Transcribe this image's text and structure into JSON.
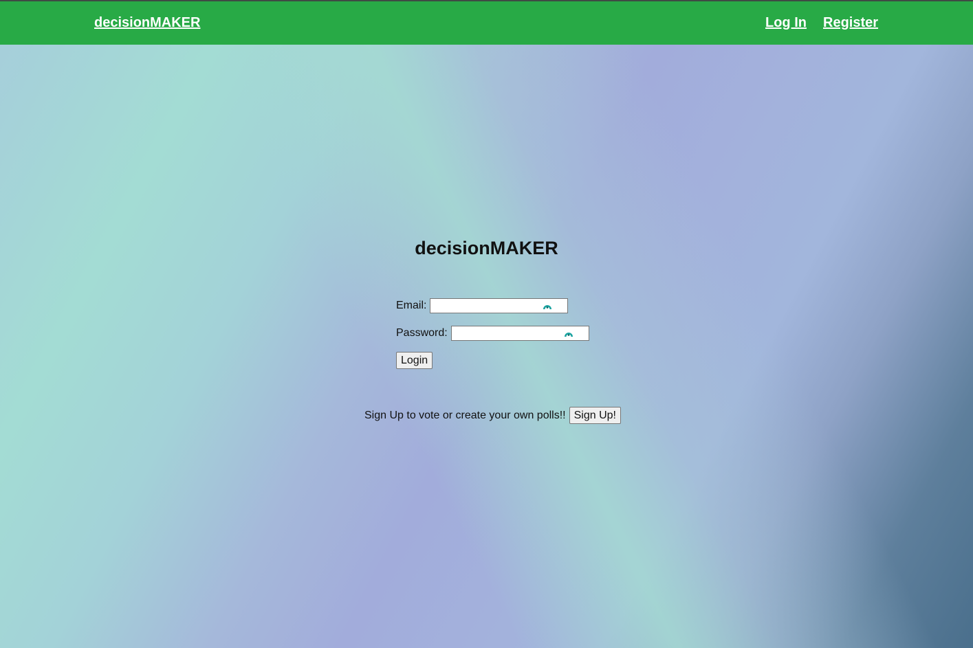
{
  "navbar": {
    "brand": "decisionMAKER",
    "login": "Log In",
    "register": "Register"
  },
  "main": {
    "title": "decisionMAKER",
    "email_label": "Email:",
    "password_label": "Password:",
    "login_button": "Login",
    "signup_text": "Sign Up to vote or create your own polls!!",
    "signup_button": "Sign Up!"
  },
  "colors": {
    "navbar": "#28aa46",
    "field_icon": "#1aa3a0"
  },
  "icons": {
    "field_icon": "password-manager-icon"
  }
}
